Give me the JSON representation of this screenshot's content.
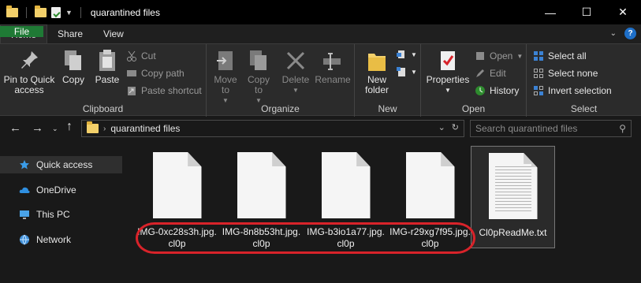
{
  "window": {
    "title": "quarantined files",
    "controls": {
      "minimize": "—",
      "maximize": "☐",
      "close": "✕"
    }
  },
  "ribbon_tabs": [
    "File",
    "Home",
    "Share",
    "View"
  ],
  "ribbon": {
    "clipboard": {
      "label": "Clipboard",
      "pin_label": "Pin to Quick access",
      "copy_label": "Copy",
      "paste_label": "Paste",
      "cut_label": "Cut",
      "copy_path_label": "Copy path",
      "paste_shortcut_label": "Paste shortcut"
    },
    "organize": {
      "label": "Organize",
      "move_to_label": "Move to",
      "copy_to_label": "Copy to",
      "delete_label": "Delete",
      "rename_label": "Rename"
    },
    "new": {
      "label": "New",
      "new_folder_label": "New folder"
    },
    "open": {
      "label": "Open",
      "properties_label": "Properties",
      "open_label": "Open",
      "edit_label": "Edit",
      "history_label": "History"
    },
    "select": {
      "label": "Select",
      "select_all_label": "Select all",
      "select_none_label": "Select none",
      "invert_label": "Invert selection"
    }
  },
  "address": {
    "crumb": "quarantined files",
    "search_placeholder": "Search quarantined files"
  },
  "nav_pane": [
    {
      "label": "Quick access",
      "icon": "star-icon"
    },
    {
      "label": "OneDrive",
      "icon": "cloud-icon"
    },
    {
      "label": "This PC",
      "icon": "computer-icon"
    },
    {
      "label": "Network",
      "icon": "network-icon"
    }
  ],
  "files": [
    {
      "name": "IMG-0xc28s3h.jpg.cl0p",
      "icon": "generic-file-icon"
    },
    {
      "name": "IMG-8n8b53ht.jpg.cl0p",
      "icon": "generic-file-icon"
    },
    {
      "name": "IMG-b3io1a77.jpg.cl0p",
      "icon": "generic-file-icon"
    },
    {
      "name": "IMG-r29xg7f95.jpg.cl0p",
      "icon": "generic-file-icon"
    },
    {
      "name": "Cl0pReadMe.txt",
      "icon": "text-file-icon"
    }
  ],
  "colors": {
    "file_tab": "#1f7a35",
    "annotation": "#d8232a",
    "folder": "#f3d06a",
    "link_blue": "#1e6fc8"
  }
}
